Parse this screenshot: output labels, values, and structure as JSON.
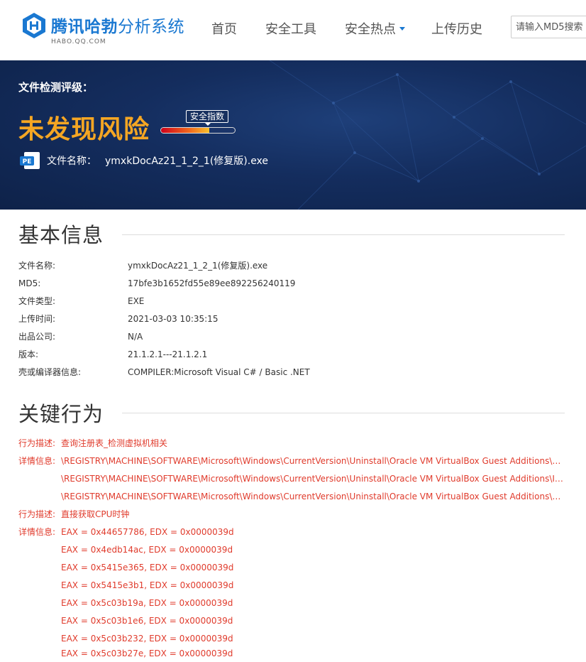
{
  "header": {
    "logo_cn_main": "腾讯哈勃",
    "logo_cn_sub": "分析系统",
    "logo_en": "HABO.QQ.COM",
    "nav": [
      {
        "label": "首页"
      },
      {
        "label": "安全工具"
      },
      {
        "label": "安全热点",
        "has_dropdown": true
      },
      {
        "label": "上传历史"
      }
    ],
    "search_placeholder": "请输入MD5搜索"
  },
  "banner": {
    "label": "文件检测评级：",
    "risk_text": "未发现风险",
    "safety_tag": "安全指数",
    "safety_level": 0.65,
    "file_icon_text": "PE",
    "file_name_label": "文件名称：",
    "file_name": "ymxkDocAz21_1_2_1(修复版).exe"
  },
  "basic_info": {
    "title": "基本信息",
    "rows": [
      {
        "key": "文件名称:",
        "value": "ymxkDocAz21_1_2_1(修复版).exe"
      },
      {
        "key": "MD5:",
        "value": "17bfe3b1652fd55e89ee892256240119"
      },
      {
        "key": "文件类型:",
        "value": "EXE"
      },
      {
        "key": "上传时间:",
        "value": "2021-03-03 10:35:15"
      },
      {
        "key": "出品公司:",
        "value": "N/A"
      },
      {
        "key": "版本:",
        "value": "21.1.2.1---21.1.2.1"
      },
      {
        "key": "壳或编译器信息:",
        "value": "COMPILER:Microsoft Visual C# / Basic .NET"
      }
    ]
  },
  "behaviors": {
    "title": "关键行为",
    "rows": [
      {
        "key": "行为描述:",
        "value": "查询注册表_检测虚拟机相关"
      },
      {
        "key": "详情信息:",
        "value": "\\REGISTRY\\MACHINE\\SOFTWARE\\Microsoft\\Windows\\CurrentVersion\\Uninstall\\Oracle VM VirtualBox Guest Additions\\Di..."
      },
      {
        "key": "",
        "value": "\\REGISTRY\\MACHINE\\SOFTWARE\\Microsoft\\Windows\\CurrentVersion\\Uninstall\\Oracle VM VirtualBox Guest Additions\\In..."
      },
      {
        "key": "",
        "value": "\\REGISTRY\\MACHINE\\SOFTWARE\\Microsoft\\Windows\\CurrentVersion\\Uninstall\\Oracle VM VirtualBox Guest Additions\\U..."
      },
      {
        "key": "行为描述:",
        "value": "直接获取CPU时钟"
      },
      {
        "key": "详情信息:",
        "value": "EAX = 0x44657786, EDX = 0x0000039d"
      },
      {
        "key": "",
        "value": "EAX = 0x4edb14ac, EDX = 0x0000039d"
      },
      {
        "key": "",
        "value": "EAX = 0x5415e365, EDX = 0x0000039d"
      },
      {
        "key": "",
        "value": "EAX = 0x5415e3b1, EDX = 0x0000039d"
      },
      {
        "key": "",
        "value": "EAX = 0x5c03b19a, EDX = 0x0000039d"
      },
      {
        "key": "",
        "value": "EAX = 0x5c03b1e6, EDX = 0x0000039d"
      },
      {
        "key": "",
        "value": "EAX = 0x5c03b232, EDX = 0x0000039d"
      },
      {
        "key": "",
        "value": "EAX = 0x5c03b27e, EDX = 0x0000039d"
      }
    ]
  },
  "colors": {
    "brand_blue": "#1a78d1",
    "risk_orange": "#f5a623",
    "behavior_red": "#e03b2c",
    "banner_navy": "#142d5e"
  }
}
